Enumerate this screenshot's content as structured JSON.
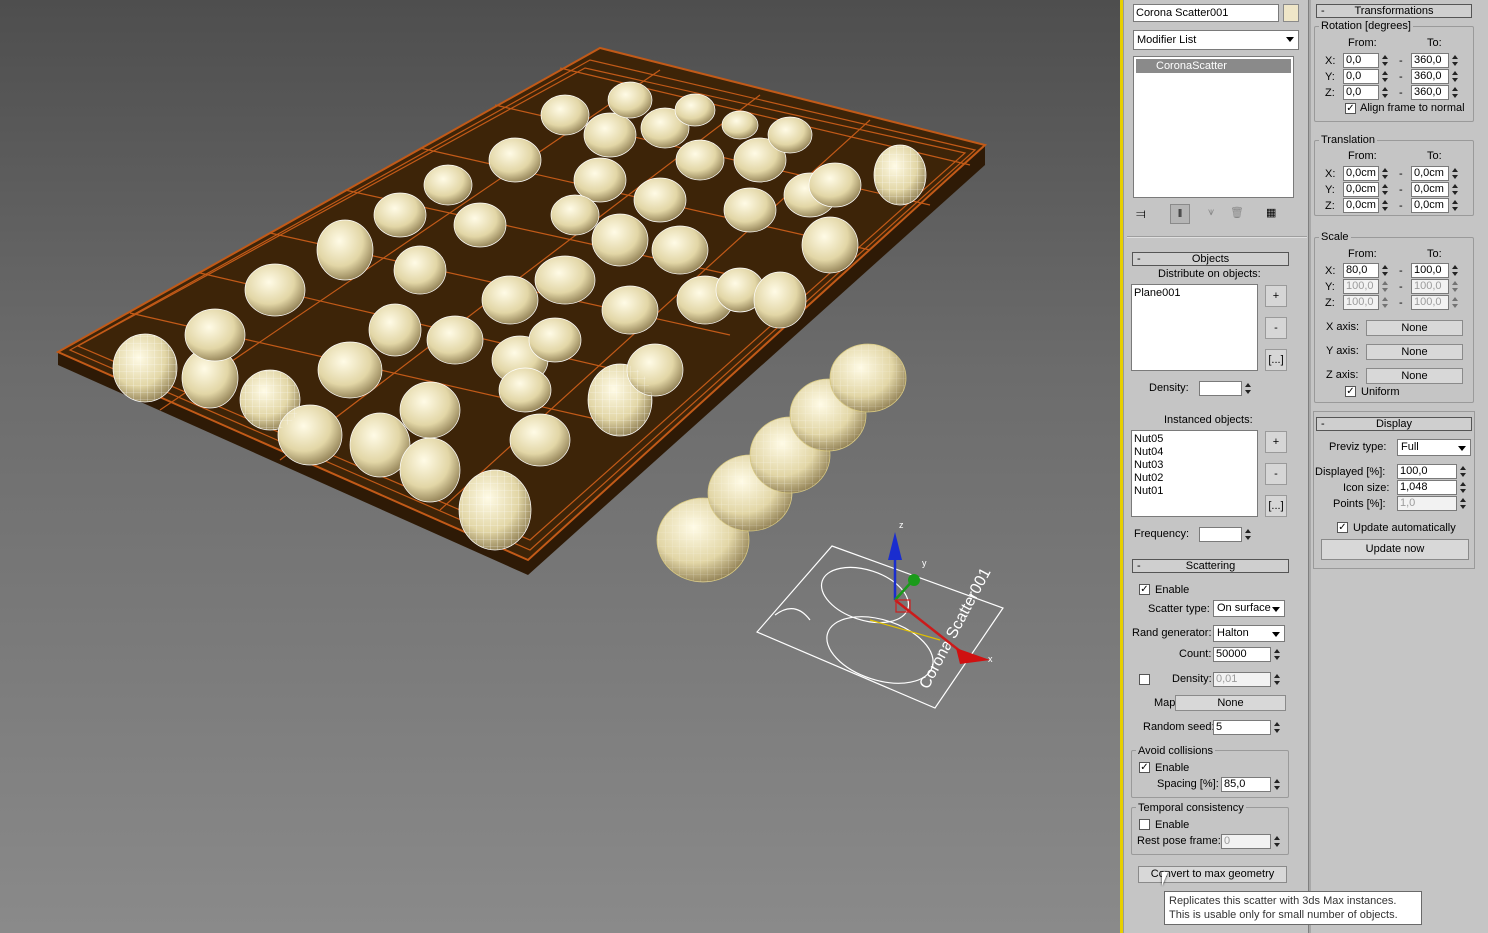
{
  "modifier_panel": {
    "object_name": "Corona Scatter001",
    "modifier_list_label": "Modifier List",
    "stack_items": [
      "CoronaScatter"
    ],
    "stack_tools": [
      "pin-stack-icon",
      "show-end-result-icon",
      "make-unique-icon",
      "remove-modifier-icon",
      "configure-modifier-sets-icon"
    ]
  },
  "objects": {
    "title": "Objects",
    "collapse": "-",
    "distribute_label": "Distribute on objects:",
    "distribute_list": [
      "Plane001"
    ],
    "density_label": "Density:",
    "density_value": "",
    "instanced_label": "Instanced objects:",
    "instanced_list": [
      "Nut05",
      "Nut04",
      "Nut03",
      "Nut02",
      "Nut01"
    ],
    "frequency_label": "Frequency:",
    "frequency_value": "",
    "add": "+",
    "remove": "-",
    "browse": "[...]"
  },
  "scattering": {
    "title": "Scattering",
    "collapse": "-",
    "enable_label": "Enable",
    "enable_checked": true,
    "scatter_type_label": "Scatter type:",
    "scatter_type_value": "On surface",
    "rand_generator_label": "Rand generator:",
    "rand_generator_value": "Halton",
    "count_label": "Count:",
    "count_value": "50000",
    "density_label": "Density:",
    "density_value": "0,01",
    "density_checked": false,
    "map_label": "Map:",
    "map_value": "None",
    "random_seed_label": "Random seed:",
    "random_seed_value": "5",
    "avoid_title": "Avoid collisions",
    "avoid_enable_label": "Enable",
    "avoid_enable_checked": true,
    "spacing_label": "Spacing [%]:",
    "spacing_value": "85,0",
    "temporal_title": "Temporal consistency",
    "temporal_enable_label": "Enable",
    "temporal_enable_checked": false,
    "rest_pose_label": "Rest pose frame:",
    "rest_pose_value": "0",
    "convert_button": "Convert to max geometry",
    "tooltip_line1": "Replicates this scatter with 3ds Max instances.",
    "tooltip_line2": "This is usable only for small number of objects."
  },
  "transformations": {
    "title": "Transformations",
    "collapse": "-",
    "rotation_title": "Rotation [degrees]",
    "from_label": "From:",
    "to_label": "To:",
    "axes": [
      "X:",
      "Y:",
      "Z:"
    ],
    "dash": "-",
    "rotation_from": [
      "0,0",
      "0,0",
      "0,0"
    ],
    "rotation_to": [
      "360,0",
      "360,0",
      "360,0"
    ],
    "align_label": "Align frame to normal",
    "align_checked": true,
    "translation_title": "Translation",
    "translation_from": [
      "0,0cm",
      "0,0cm",
      "0,0cm"
    ],
    "translation_to": [
      "0,0cm",
      "0,0cm",
      "0,0cm"
    ],
    "scale_title": "Scale",
    "scale_from": [
      "80,0",
      "100,0",
      "100,0"
    ],
    "scale_to": [
      "100,0",
      "100,0",
      "100,0"
    ],
    "x_axis_label": "X axis:",
    "y_axis_label": "Y axis:",
    "z_axis_label": "Z axis:",
    "axis_map_value": "None",
    "uniform_label": "Uniform",
    "uniform_checked": true
  },
  "display": {
    "title": "Display",
    "collapse": "-",
    "previz_label": "Previz type:",
    "previz_value": "Full",
    "displayed_label": "Displayed [%]:",
    "displayed_value": "100,0",
    "icon_size_label": "Icon size:",
    "icon_size_value": "1,048",
    "points_label": "Points [%]:",
    "points_value": "1,0",
    "update_auto_label": "Update automatically",
    "update_auto_checked": true,
    "update_now_button": "Update now"
  },
  "viewport": {
    "gizmo_labels": {
      "z": "z",
      "y": "y",
      "x": "x"
    },
    "icon_text": "Corona Scatter001",
    "colors": {
      "tray": "#3b2106",
      "tray_wire": "#c0581a",
      "nut": "#e6dbb0",
      "selection": "#ffffff"
    }
  }
}
